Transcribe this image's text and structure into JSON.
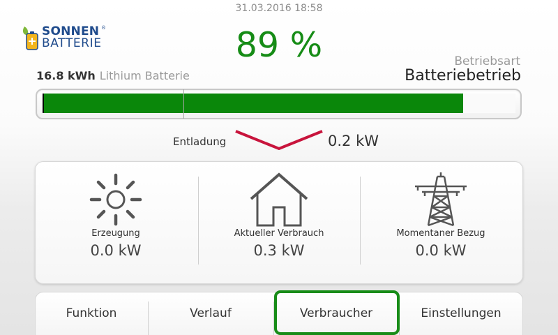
{
  "header": {
    "datetime": "31.03.2016 18:58",
    "logo_top": "SONNEN",
    "logo_bottom": "BATTERIE",
    "logo_sup": "®"
  },
  "battery": {
    "soc_text": "89 %",
    "soc_percent": 89,
    "capacity": "16.8 kWh",
    "type": "Lithium Batterie",
    "fill_color": "#0a870a"
  },
  "mode": {
    "label": "Betriebsart",
    "value": "Batteriebetrieb"
  },
  "flow": {
    "label": "Entladung",
    "value": "0.2 kW",
    "arrow_color": "#c8143c"
  },
  "stats": [
    {
      "icon": "sun-icon",
      "label": "Erzeugung",
      "value": "0.0 kW"
    },
    {
      "icon": "house-icon",
      "label": "Aktueller Verbrauch",
      "value": "0.3 kW"
    },
    {
      "icon": "power-pylon-icon",
      "label": "Momentaner Bezug",
      "value": "0.0 kW"
    }
  ],
  "nav": {
    "items": [
      {
        "label": "Funktion"
      },
      {
        "label": "Verlauf"
      },
      {
        "label": "Verbraucher"
      },
      {
        "label": "Einstellungen"
      }
    ],
    "active_index": 2,
    "active_color": "#188c18"
  }
}
